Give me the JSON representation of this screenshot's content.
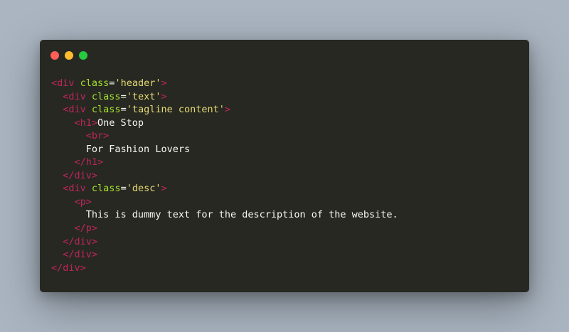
{
  "window": {
    "buttons": {
      "close_color": "#ff5f56",
      "minimize_color": "#ffbd2e",
      "maximize_color": "#27c93f"
    }
  },
  "code": {
    "lines": [
      {
        "indent": "",
        "parts": [
          {
            "t": "tag",
            "v": "<div"
          },
          {
            "t": "txt",
            "v": " "
          },
          {
            "t": "attr",
            "v": "class"
          },
          {
            "t": "pun",
            "v": "="
          },
          {
            "t": "str",
            "v": "'header'"
          },
          {
            "t": "tag",
            "v": ">"
          }
        ]
      },
      {
        "indent": "  ",
        "parts": [
          {
            "t": "tag",
            "v": "<div"
          },
          {
            "t": "txt",
            "v": " "
          },
          {
            "t": "attr",
            "v": "class"
          },
          {
            "t": "pun",
            "v": "="
          },
          {
            "t": "str",
            "v": "'text'"
          },
          {
            "t": "tag",
            "v": ">"
          }
        ]
      },
      {
        "indent": "  ",
        "parts": [
          {
            "t": "tag",
            "v": "<div"
          },
          {
            "t": "txt",
            "v": " "
          },
          {
            "t": "attr",
            "v": "class"
          },
          {
            "t": "pun",
            "v": "="
          },
          {
            "t": "str",
            "v": "'tagline content'"
          },
          {
            "t": "tag",
            "v": ">"
          }
        ]
      },
      {
        "indent": "    ",
        "parts": [
          {
            "t": "tag",
            "v": "<h1>"
          },
          {
            "t": "txt",
            "v": "One Stop"
          }
        ]
      },
      {
        "indent": "      ",
        "parts": [
          {
            "t": "tag",
            "v": "<br>"
          }
        ]
      },
      {
        "indent": "      ",
        "parts": [
          {
            "t": "txt",
            "v": "For Fashion Lovers"
          }
        ]
      },
      {
        "indent": "    ",
        "parts": [
          {
            "t": "tag",
            "v": "</h1>"
          }
        ]
      },
      {
        "indent": "  ",
        "parts": [
          {
            "t": "tag",
            "v": "</div>"
          }
        ]
      },
      {
        "indent": "  ",
        "parts": [
          {
            "t": "tag",
            "v": "<div"
          },
          {
            "t": "txt",
            "v": " "
          },
          {
            "t": "attr",
            "v": "class"
          },
          {
            "t": "pun",
            "v": "="
          },
          {
            "t": "str",
            "v": "'desc'"
          },
          {
            "t": "tag",
            "v": ">"
          }
        ]
      },
      {
        "indent": "    ",
        "parts": [
          {
            "t": "tag",
            "v": "<p>"
          }
        ]
      },
      {
        "indent": "      ",
        "parts": [
          {
            "t": "txt",
            "v": "This is dummy text for the description of the website."
          }
        ]
      },
      {
        "indent": "    ",
        "parts": [
          {
            "t": "tag",
            "v": "</p>"
          }
        ]
      },
      {
        "indent": "  ",
        "parts": [
          {
            "t": "tag",
            "v": "</div>"
          }
        ]
      },
      {
        "indent": "  ",
        "parts": [
          {
            "t": "tag",
            "v": "</div>"
          }
        ]
      },
      {
        "indent": "",
        "parts": [
          {
            "t": "tag",
            "v": "</div>"
          }
        ]
      }
    ]
  }
}
